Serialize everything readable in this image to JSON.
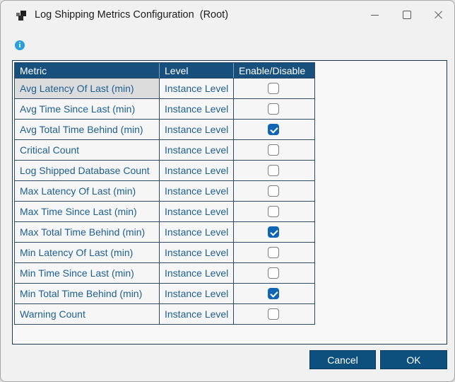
{
  "window": {
    "title": "Log Shipping Metrics Configuration  (Root)"
  },
  "table": {
    "headers": [
      "Metric",
      "Level",
      "Enable/Disable"
    ],
    "rows": [
      {
        "metric": "Avg Latency Of Last (min)",
        "level": "Instance Level",
        "enabled": false,
        "selected": true
      },
      {
        "metric": "Avg Time Since Last (min)",
        "level": "Instance Level",
        "enabled": false
      },
      {
        "metric": "Avg Total Time Behind (min)",
        "level": "Instance Level",
        "enabled": true
      },
      {
        "metric": "Critical Count",
        "level": "Instance Level",
        "enabled": false
      },
      {
        "metric": "Log Shipped Database Count",
        "level": "Instance Level",
        "enabled": false
      },
      {
        "metric": "Max Latency Of Last (min)",
        "level": "Instance Level",
        "enabled": false
      },
      {
        "metric": "Max Time Since Last (min)",
        "level": "Instance Level",
        "enabled": false
      },
      {
        "metric": "Max Total Time Behind (min)",
        "level": "Instance Level",
        "enabled": true
      },
      {
        "metric": "Min Latency Of Last (min)",
        "level": "Instance Level",
        "enabled": false
      },
      {
        "metric": "Min Time Since Last (min)",
        "level": "Instance Level",
        "enabled": false
      },
      {
        "metric": "Min Total Time Behind (min)",
        "level": "Instance Level",
        "enabled": true
      },
      {
        "metric": "Warning Count",
        "level": "Instance Level",
        "enabled": false
      }
    ]
  },
  "buttons": {
    "cancel": "Cancel",
    "ok": "OK"
  },
  "icons": {
    "info_glyph": "i"
  },
  "colors": {
    "header_bg": "#17507d",
    "row_text": "#1d6094",
    "checkbox_checked": "#1166b3",
    "button_bg": "#0d507e",
    "info_icon": "#28a0da",
    "selected_cell_bg": "#dcdcdc",
    "dialog_bg": "#f2f1f1"
  }
}
